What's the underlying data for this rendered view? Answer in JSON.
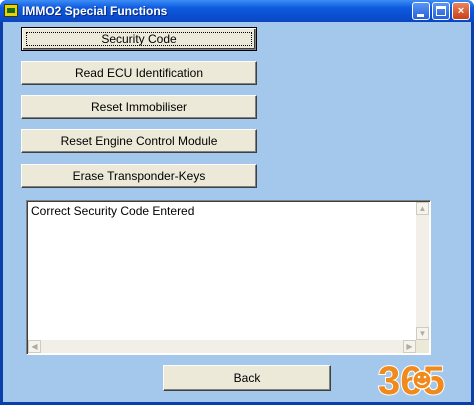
{
  "window": {
    "title": "IMMO2 Special Functions",
    "controls": {
      "minimize": "",
      "maximize": "",
      "close": "×"
    }
  },
  "functions": [
    {
      "label": "Security Code",
      "focused": true
    },
    {
      "label": "Read ECU Identification",
      "focused": false
    },
    {
      "label": "Reset Immobiliser",
      "focused": false
    },
    {
      "label": "Reset Engine Control Module",
      "focused": false
    },
    {
      "label": "Erase Transponder-Keys",
      "focused": false
    }
  ],
  "output": {
    "text": "Correct Security Code Entered"
  },
  "footer": {
    "back_label": "Back"
  },
  "watermark": {
    "text": "365"
  },
  "colors": {
    "client_bg": "#a4c8ec",
    "button_face": "#ece9d8",
    "titlebar": "#0f5be0",
    "watermark": "#f08a1c"
  }
}
